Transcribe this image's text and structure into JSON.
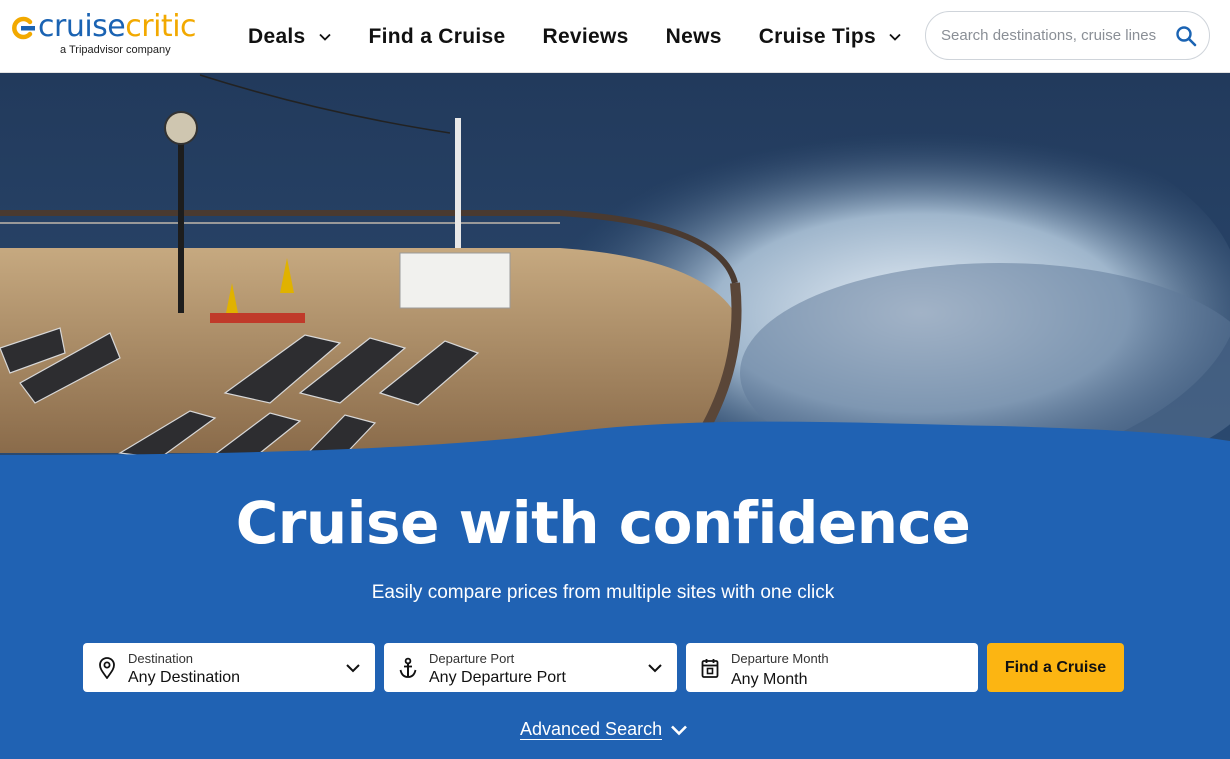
{
  "brand": {
    "name_part1": "cruise",
    "name_part2": "critic",
    "tagline": "a Tripadvisor company",
    "colors": {
      "blue": "#1a63b3",
      "gold": "#f2a900"
    }
  },
  "nav": {
    "items": [
      {
        "label": "Deals",
        "has_dropdown": true
      },
      {
        "label": "Find a Cruise",
        "has_dropdown": false
      },
      {
        "label": "Reviews",
        "has_dropdown": false
      },
      {
        "label": "News",
        "has_dropdown": false
      },
      {
        "label": "Cruise Tips",
        "has_dropdown": true
      }
    ]
  },
  "search": {
    "placeholder": "Search destinations, cruise lines",
    "icon": "search-icon"
  },
  "hero": {
    "title": "Cruise with confidence",
    "subtitle": "Easily compare prices from multiple sites with one click",
    "background_color": "#2062b3"
  },
  "filters": {
    "destination": {
      "label": "Destination",
      "value": "Any Destination",
      "icon": "map-pin-icon"
    },
    "departure_port": {
      "label": "Departure Port",
      "value": "Any Departure Port",
      "icon": "anchor-icon"
    },
    "departure_month": {
      "label": "Departure Month",
      "value": "Any Month",
      "icon": "calendar-icon"
    },
    "submit_label": "Find a Cruise",
    "submit_color": "#fcb512",
    "advanced_label": "Advanced Search"
  }
}
